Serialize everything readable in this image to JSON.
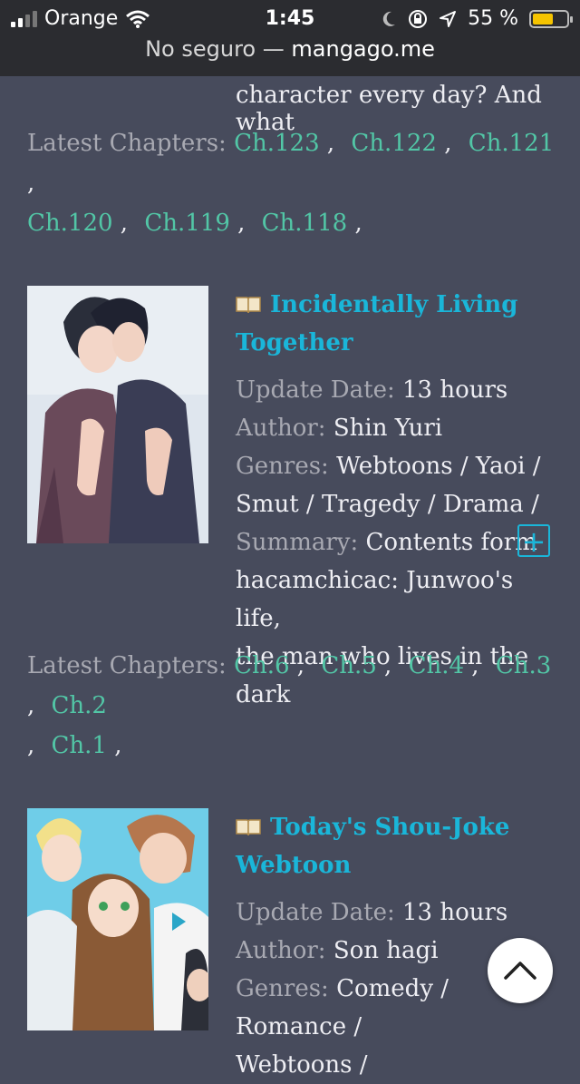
{
  "status": {
    "carrier": "Orange",
    "time": "1:45",
    "battery": "55 %"
  },
  "browser": {
    "security": "No seguro",
    "dash": "—",
    "host": "mangago.me"
  },
  "prev_entry": {
    "summary_tail": "character every day? And what",
    "latest_label": "Latest Chapters:",
    "chapters": [
      "Ch.123",
      "Ch.122",
      "Ch.121",
      "Ch.120",
      "Ch.119",
      "Ch.118"
    ]
  },
  "entries": [
    {
      "title_line1": "Incidentally Living",
      "title_line2": "Together",
      "update_label": "Update Date:",
      "update_value": "13 hours",
      "author_label": "Author:",
      "author_value": "Shin Yuri",
      "genres_label": "Genres:",
      "genres_line1": "Webtoons / Yaoi /",
      "genres_line2": "Smut / Tragedy / Drama /",
      "summary_label": "Summary:",
      "summary_line1": "Contents form",
      "summary_line2": "hacamchicac: Junwoo's life,",
      "summary_line3": "the man who lives in the dark",
      "latest_label": "Latest Chapters:",
      "chapters": [
        "Ch.6",
        "Ch.5",
        "Ch.4",
        "Ch.3",
        "Ch.2",
        "Ch.1"
      ],
      "expand": "+"
    },
    {
      "title_line1": "Today's Shou-Joke",
      "title_line2": "Webtoon",
      "update_label": "Update Date:",
      "update_value": "13 hours",
      "author_label": "Author:",
      "author_value": "Son hagi",
      "genres_label": "Genres:",
      "genres_line1": "Comedy / Romance /",
      "genres_line2": "Webtoons /"
    }
  ],
  "colors": {
    "background": "#474b5c",
    "title": "#1ab6d9",
    "chapter_link": "#52c6a6",
    "label": "#a8a9b2"
  },
  "icons": {
    "scroll_top": "chevron-up-icon",
    "book": "book-icon",
    "expand": "plus-icon"
  }
}
